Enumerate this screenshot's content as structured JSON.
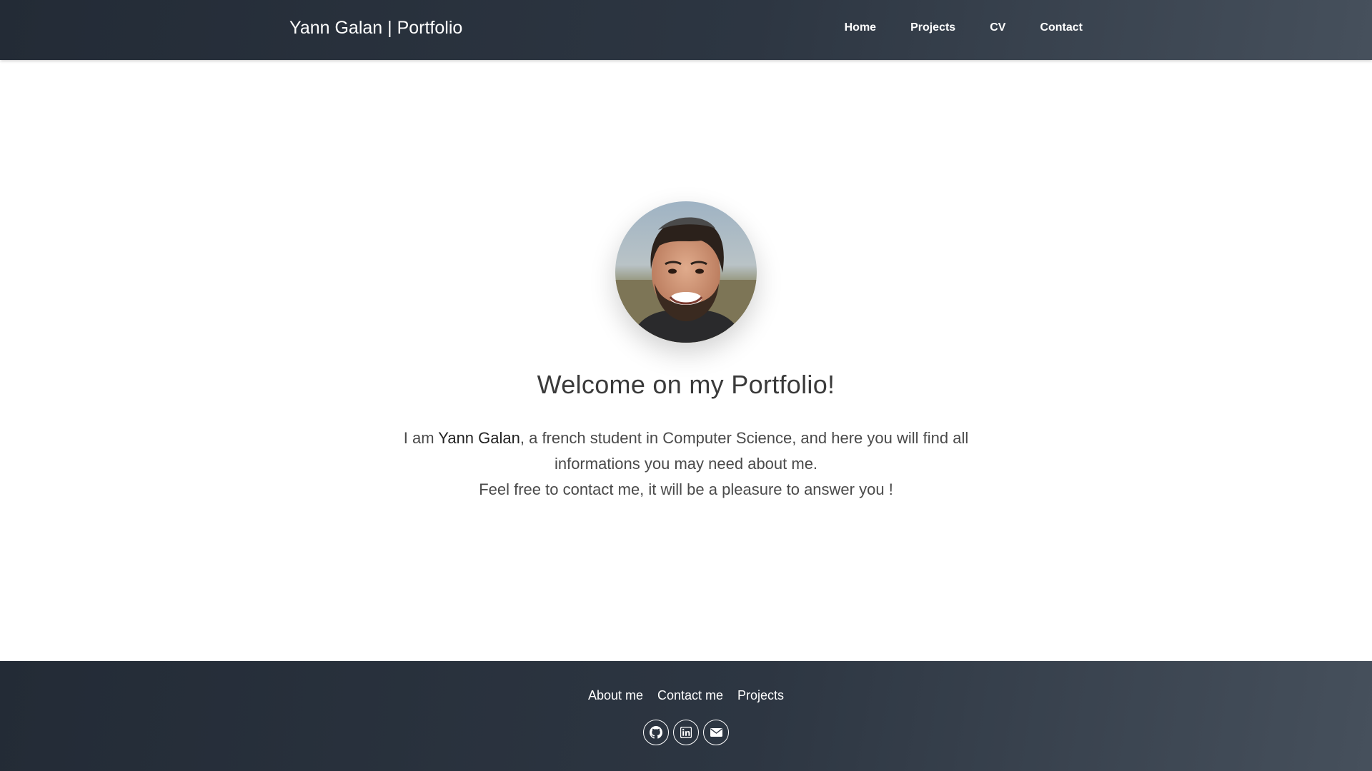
{
  "navbar": {
    "brand": "Yann Galan | Portfolio",
    "links": [
      "Home",
      "Projects",
      "CV",
      "Contact"
    ]
  },
  "hero": {
    "welcome": "Welcome on my Portfolio!",
    "intro_prefix": "I am ",
    "intro_name": "Yann Galan",
    "intro_rest": ", a french student in Computer Science, and here you will find all informations you may need about me.",
    "intro_line3": "Feel free to contact me, it will be a pleasure to answer you !"
  },
  "footer": {
    "links": [
      "About me",
      "Contact me",
      "Projects"
    ],
    "socials": [
      "github-icon",
      "linkedin-icon",
      "envelope-icon"
    ]
  },
  "colors": {
    "header_bg": "#2d3642",
    "text": "#4a4a4a",
    "white": "#ffffff"
  }
}
